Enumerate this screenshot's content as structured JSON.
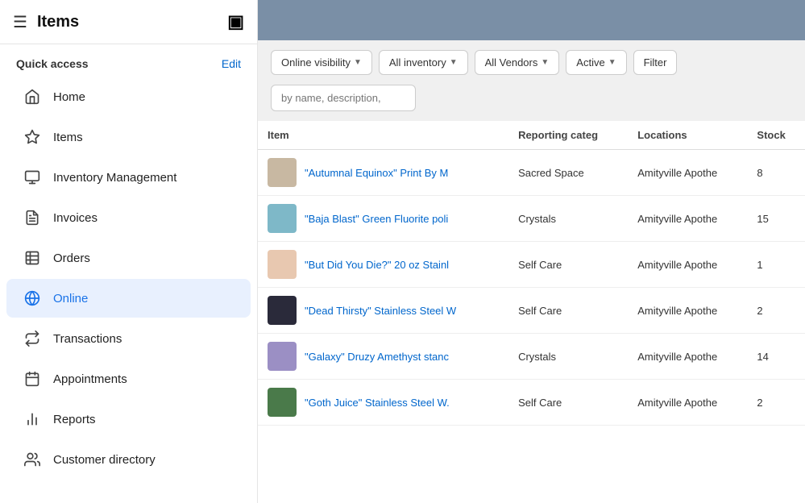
{
  "header": {
    "menu_icon": "☰",
    "title": "Items",
    "logo": "▣"
  },
  "sidebar": {
    "quick_access_label": "Quick access",
    "edit_label": "Edit",
    "nav_items": [
      {
        "id": "home",
        "label": "Home",
        "icon": "home",
        "active": false
      },
      {
        "id": "items",
        "label": "Items",
        "icon": "items",
        "active": false
      },
      {
        "id": "inventory",
        "label": "Inventory Management",
        "icon": "inventory",
        "active": false
      },
      {
        "id": "invoices",
        "label": "Invoices",
        "icon": "invoices",
        "active": false
      },
      {
        "id": "orders",
        "label": "Orders",
        "icon": "orders",
        "active": false
      },
      {
        "id": "online",
        "label": "Online",
        "icon": "online",
        "active": true
      },
      {
        "id": "transactions",
        "label": "Transactions",
        "icon": "transactions",
        "active": false
      },
      {
        "id": "appointments",
        "label": "Appointments",
        "icon": "appointments",
        "active": false
      },
      {
        "id": "reports",
        "label": "Reports",
        "icon": "reports",
        "active": false
      },
      {
        "id": "customer-directory",
        "label": "Customer directory",
        "icon": "customers",
        "active": false
      }
    ]
  },
  "filters": {
    "online_visibility": "Online visibility",
    "all_inventory": "All inventory",
    "all_vendors": "All Vendors",
    "active": "Active",
    "filter": "Filter"
  },
  "search": {
    "placeholder": "by name, description,"
  },
  "table": {
    "columns": [
      "Item",
      "Reporting categ",
      "Locations",
      "Stock"
    ],
    "rows": [
      {
        "name": "\"Autumnal Equinox\" Print By M",
        "category": "Sacred Space",
        "location": "Amityville Apothe",
        "stock": "8",
        "thumb_class": "thumb-1"
      },
      {
        "name": "\"Baja Blast\" Green Fluorite poli",
        "category": "Crystals",
        "location": "Amityville Apothe",
        "stock": "15",
        "thumb_class": "thumb-2"
      },
      {
        "name": "\"But Did You Die?\" 20 oz Stainl",
        "category": "Self Care",
        "location": "Amityville Apothe",
        "stock": "1",
        "thumb_class": "thumb-3"
      },
      {
        "name": "\"Dead Thirsty\" Stainless Steel W",
        "category": "Self Care",
        "location": "Amityville Apothe",
        "stock": "2",
        "thumb_class": "thumb-4"
      },
      {
        "name": "\"Galaxy\" Druzy Amethyst stanc",
        "category": "Crystals",
        "location": "Amityville Apothe",
        "stock": "14",
        "thumb_class": "thumb-5"
      },
      {
        "name": "\"Goth Juice\" Stainless Steel W.",
        "category": "Self Care",
        "location": "Amityville Apothe",
        "stock": "2",
        "thumb_class": "thumb-6"
      }
    ]
  }
}
